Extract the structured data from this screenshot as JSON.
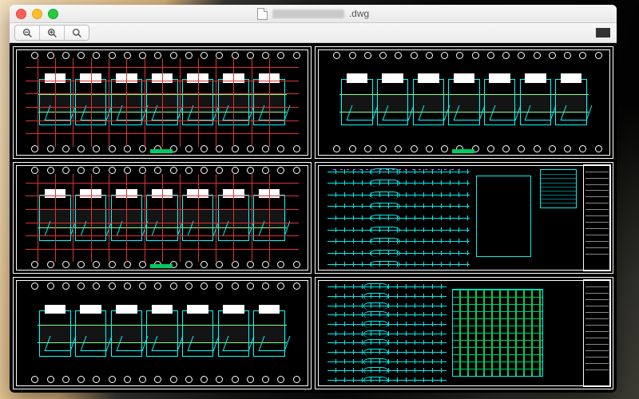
{
  "window": {
    "file_extension": ".dwg"
  },
  "toolbar": {
    "zoom_out_tip": "Zoom Out",
    "zoom_in_tip": "Zoom In",
    "zoom_fit_tip": "Zoom to Fit"
  },
  "sheets": {
    "count": 6,
    "layout": "2x3",
    "types": [
      "floor-plan",
      "floor-plan",
      "floor-plan",
      "riser-schematic",
      "floor-plan",
      "riser-schematic"
    ],
    "layer_colors": {
      "grid": "#ffffff",
      "architecture_overlay": "#d33333",
      "plumbing": "#00eeee",
      "annotation": "#00cc66",
      "electrical": "#f040f0"
    }
  }
}
